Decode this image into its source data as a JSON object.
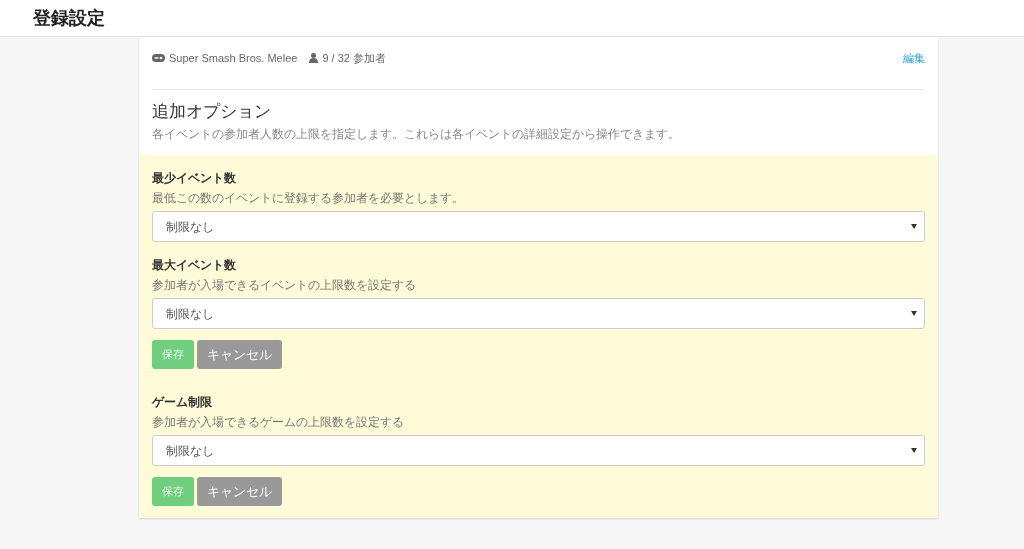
{
  "header": {
    "title": "登録設定"
  },
  "event": {
    "game": "Super Smash Bros. Melee",
    "entrants": "9 / 32 参加者",
    "edit_link": "編集"
  },
  "options": {
    "title": "追加オプション",
    "description": "各イベントの参加者人数の上限を指定します。これらは各イベントの詳細設定から操作できます。",
    "groups": [
      {
        "fields": [
          {
            "label": "最少イベント数",
            "help": "最低この数のイベントに登録する参加者を必要とします。",
            "value": "制限なし"
          },
          {
            "label": "最大イベント数",
            "help": "参加者が入場できるイベントの上限数を設定する",
            "value": "制限なし"
          }
        ],
        "save": {
          "label": "保存",
          "disabled": true
        },
        "cancel": {
          "label": "キャンセル"
        }
      },
      {
        "fields": [
          {
            "label": "ゲーム制限",
            "help": "参加者が入場できるゲームの上限数を設定する",
            "value": "制限なし"
          }
        ],
        "save": {
          "label": "保存",
          "disabled": true
        },
        "cancel": {
          "label": "キャンセル"
        }
      }
    ]
  }
}
